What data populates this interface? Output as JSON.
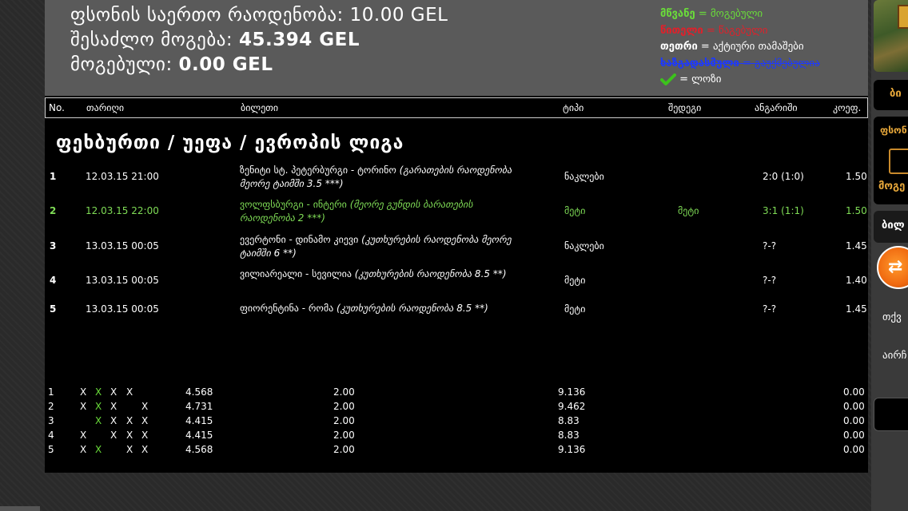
{
  "summary": {
    "total_season_label": "ფსონის საერთო რაოდენობა:",
    "total_season_value": "10.00 GEL",
    "possible_win_label": "შესაძლო მოგება:",
    "possible_win_value": "45.394 GEL",
    "won_label": "მოგებული:",
    "won_value": "0.00 GEL"
  },
  "legend": {
    "green_key": "მწვანე",
    "green_val": "= მოგებული",
    "red_key": "წითელი",
    "red_val": "= წაგებული",
    "white_key": "თეთრი",
    "white_val": "= აქტიური თამაშები",
    "blue_key": "ხაზგადასმული",
    "blue_val": "= გაუქმებულია",
    "check_val": "= ლოზი",
    "colors": {
      "green": "#6adc3a",
      "red": "#e0202a",
      "blue": "#1d39ff"
    }
  },
  "table_headers": {
    "no": "No.",
    "date": "თარიღი",
    "ticket": "ბილეთი",
    "type": "ტიპი",
    "result": "შედეგი",
    "score": "ანგარიში",
    "coef": "კოეფ."
  },
  "section_title": "ფეხბურთი / უეფა / ევროპის ლიგა",
  "bets": [
    {
      "no": "1",
      "date": "12.03.15 21:00",
      "match": "ზენიტი სტ. პეტერბურგი - ტორინო ",
      "market": "(გარათების რაოდენობა მეორე ტაიმში 3.5 ***)",
      "type": "ნაკლები",
      "result": "",
      "score": "2:0 (1:0)",
      "coef": "1.50"
    },
    {
      "no": "2",
      "date": "12.03.15 22:00",
      "match": "ვოლფსბურგი - ინტერი ",
      "market": "(მეორე გუნდის ბარათების რაოდენობა 2 ***)",
      "type": "მეტი",
      "result": "მეტი",
      "score": "3:1 (1:1)",
      "coef": "1.50"
    },
    {
      "no": "3",
      "date": "13.03.15 00:05",
      "match": "ევერტონი - დინამო კიევი ",
      "market": "(კუთხურების რაოდენობა მეორე ტაიმში 6 **)",
      "type": "ნაკლები",
      "result": "",
      "score": "?-?",
      "coef": "1.45"
    },
    {
      "no": "4",
      "date": "13.03.15 00:05",
      "match": "ვილიარეალი - სევილია ",
      "market": "(კუთხურების რაოდენობა 8.5 **)",
      "type": "მეტი",
      "result": "",
      "score": "?-?",
      "coef": "1.40"
    },
    {
      "no": "5",
      "date": "13.03.15 00:05",
      "match": "ფიორენტინა - რომა ",
      "market": "(კუთხურების რაოდენობა 8.5 **)",
      "type": "მეტი",
      "result": "",
      "score": "?-?",
      "coef": "1.45"
    }
  ],
  "combos": [
    {
      "no": "1",
      "marks": [
        "X",
        "X",
        "X",
        "X",
        ""
      ],
      "odds": "4.568",
      "stake": "2.00",
      "ret": "9.136",
      "win": "0.00"
    },
    {
      "no": "2",
      "marks": [
        "X",
        "X",
        "X",
        "",
        "X"
      ],
      "odds": "4.731",
      "stake": "2.00",
      "ret": "9.462",
      "win": "0.00"
    },
    {
      "no": "3",
      "marks": [
        "",
        "X",
        "X",
        "X",
        "X"
      ],
      "odds": "4.415",
      "stake": "2.00",
      "ret": "8.83",
      "win": "0.00"
    },
    {
      "no": "4",
      "marks": [
        "X",
        "",
        "X",
        "X",
        "X"
      ],
      "odds": "4.415",
      "stake": "2.00",
      "ret": "8.83",
      "win": "0.00"
    },
    {
      "no": "5",
      "marks": [
        "X",
        "X",
        "",
        "X",
        "X"
      ],
      "odds": "4.568",
      "stake": "2.00",
      "ret": "9.136",
      "win": "0.00"
    }
  ],
  "right_panel": {
    "tab1": "ბი",
    "label1": "ფსონ",
    "label2": "მოგე",
    "tab2": "ბილ",
    "text1": "თქვ",
    "text2": "აირჩ"
  }
}
